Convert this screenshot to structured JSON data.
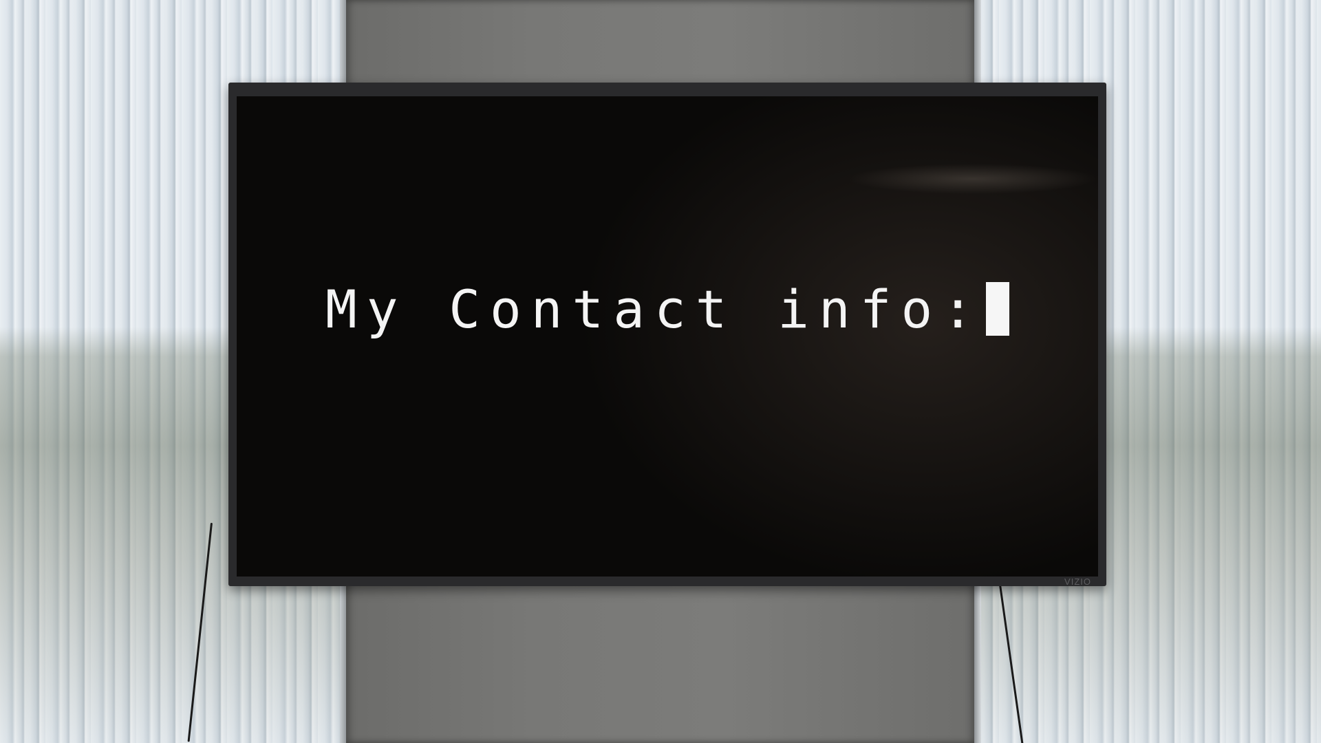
{
  "scene": {
    "screen_text": "My Contact info:",
    "cursor": "block-cursor",
    "tv_brand_logo": "VIZIO"
  },
  "colors": {
    "screen_background": "#0a0908",
    "text_color": "#f4f4f4",
    "tv_bezel": "#2a2a2c",
    "pillar": "#787876"
  }
}
